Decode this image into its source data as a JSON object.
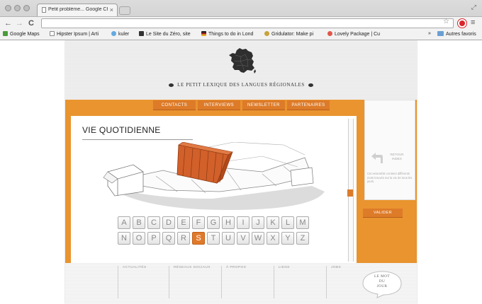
{
  "browser": {
    "tab_title": "Petit problème... Google Ch",
    "tab_close": "×",
    "menu_glyph": "≡",
    "star_glyph": "☆",
    "expand_glyph": "⤢",
    "back_glyph": "←",
    "forward_glyph": "→",
    "reload_glyph": "C",
    "bookmarks": [
      {
        "label": "Google Maps",
        "icon": "google-maps-icon",
        "color": "#4a9b3b"
      },
      {
        "label": "Hipster Ipsum | Arti",
        "icon": "page-icon",
        "color": "#ffffff"
      },
      {
        "label": "kuler",
        "icon": "kuler-icon",
        "color": "#63a9e0"
      },
      {
        "label": "Le Site du Zéro, site",
        "icon": "zero-icon",
        "color": "#333333"
      },
      {
        "label": "Things to do in Lond",
        "icon": "things-icon",
        "color": "#b32020"
      },
      {
        "label": "Gridulator: Make pi",
        "icon": "gridulator-icon",
        "color": "#c8a23a"
      },
      {
        "label": "Lovely Package | Cu",
        "icon": "heart-icon",
        "color": "#e0574a"
      }
    ],
    "bookmarks_more": "»",
    "other_bookmarks": "Autres favoris"
  },
  "site": {
    "title": "LE PETIT LEXIQUE DES LANGUES RÉGIONALES",
    "nav": [
      "CONTACTS",
      "INTERVIEWS",
      "NEWSLETTER",
      "PARTENAIRES"
    ],
    "content_title": "VIE QUOTIDIENNE",
    "alphabet": [
      "A",
      "B",
      "C",
      "D",
      "E",
      "F",
      "G",
      "H",
      "I",
      "J",
      "K",
      "L",
      "M",
      "N",
      "O",
      "P",
      "Q",
      "R",
      "S",
      "T",
      "U",
      "V",
      "W",
      "X",
      "Y",
      "Z"
    ],
    "selected_letter": "S",
    "side": {
      "back_label": "RETOUR INDEX",
      "description": "Cet ensemble contient différents mots trouvés sur la vie de tous les jours.",
      "validate": "VALIDER"
    },
    "footer": [
      "ACTUALITÉS",
      "RÉSEAUX SOCIAUX",
      "À PROPOS",
      "LIENS",
      "JOBS"
    ],
    "word_of_day": [
      "LE MOT",
      "DU",
      "JOUR"
    ]
  },
  "colors": {
    "accent": "#e9942f",
    "button": "#dd7b29",
    "crate": "#d2602a"
  }
}
